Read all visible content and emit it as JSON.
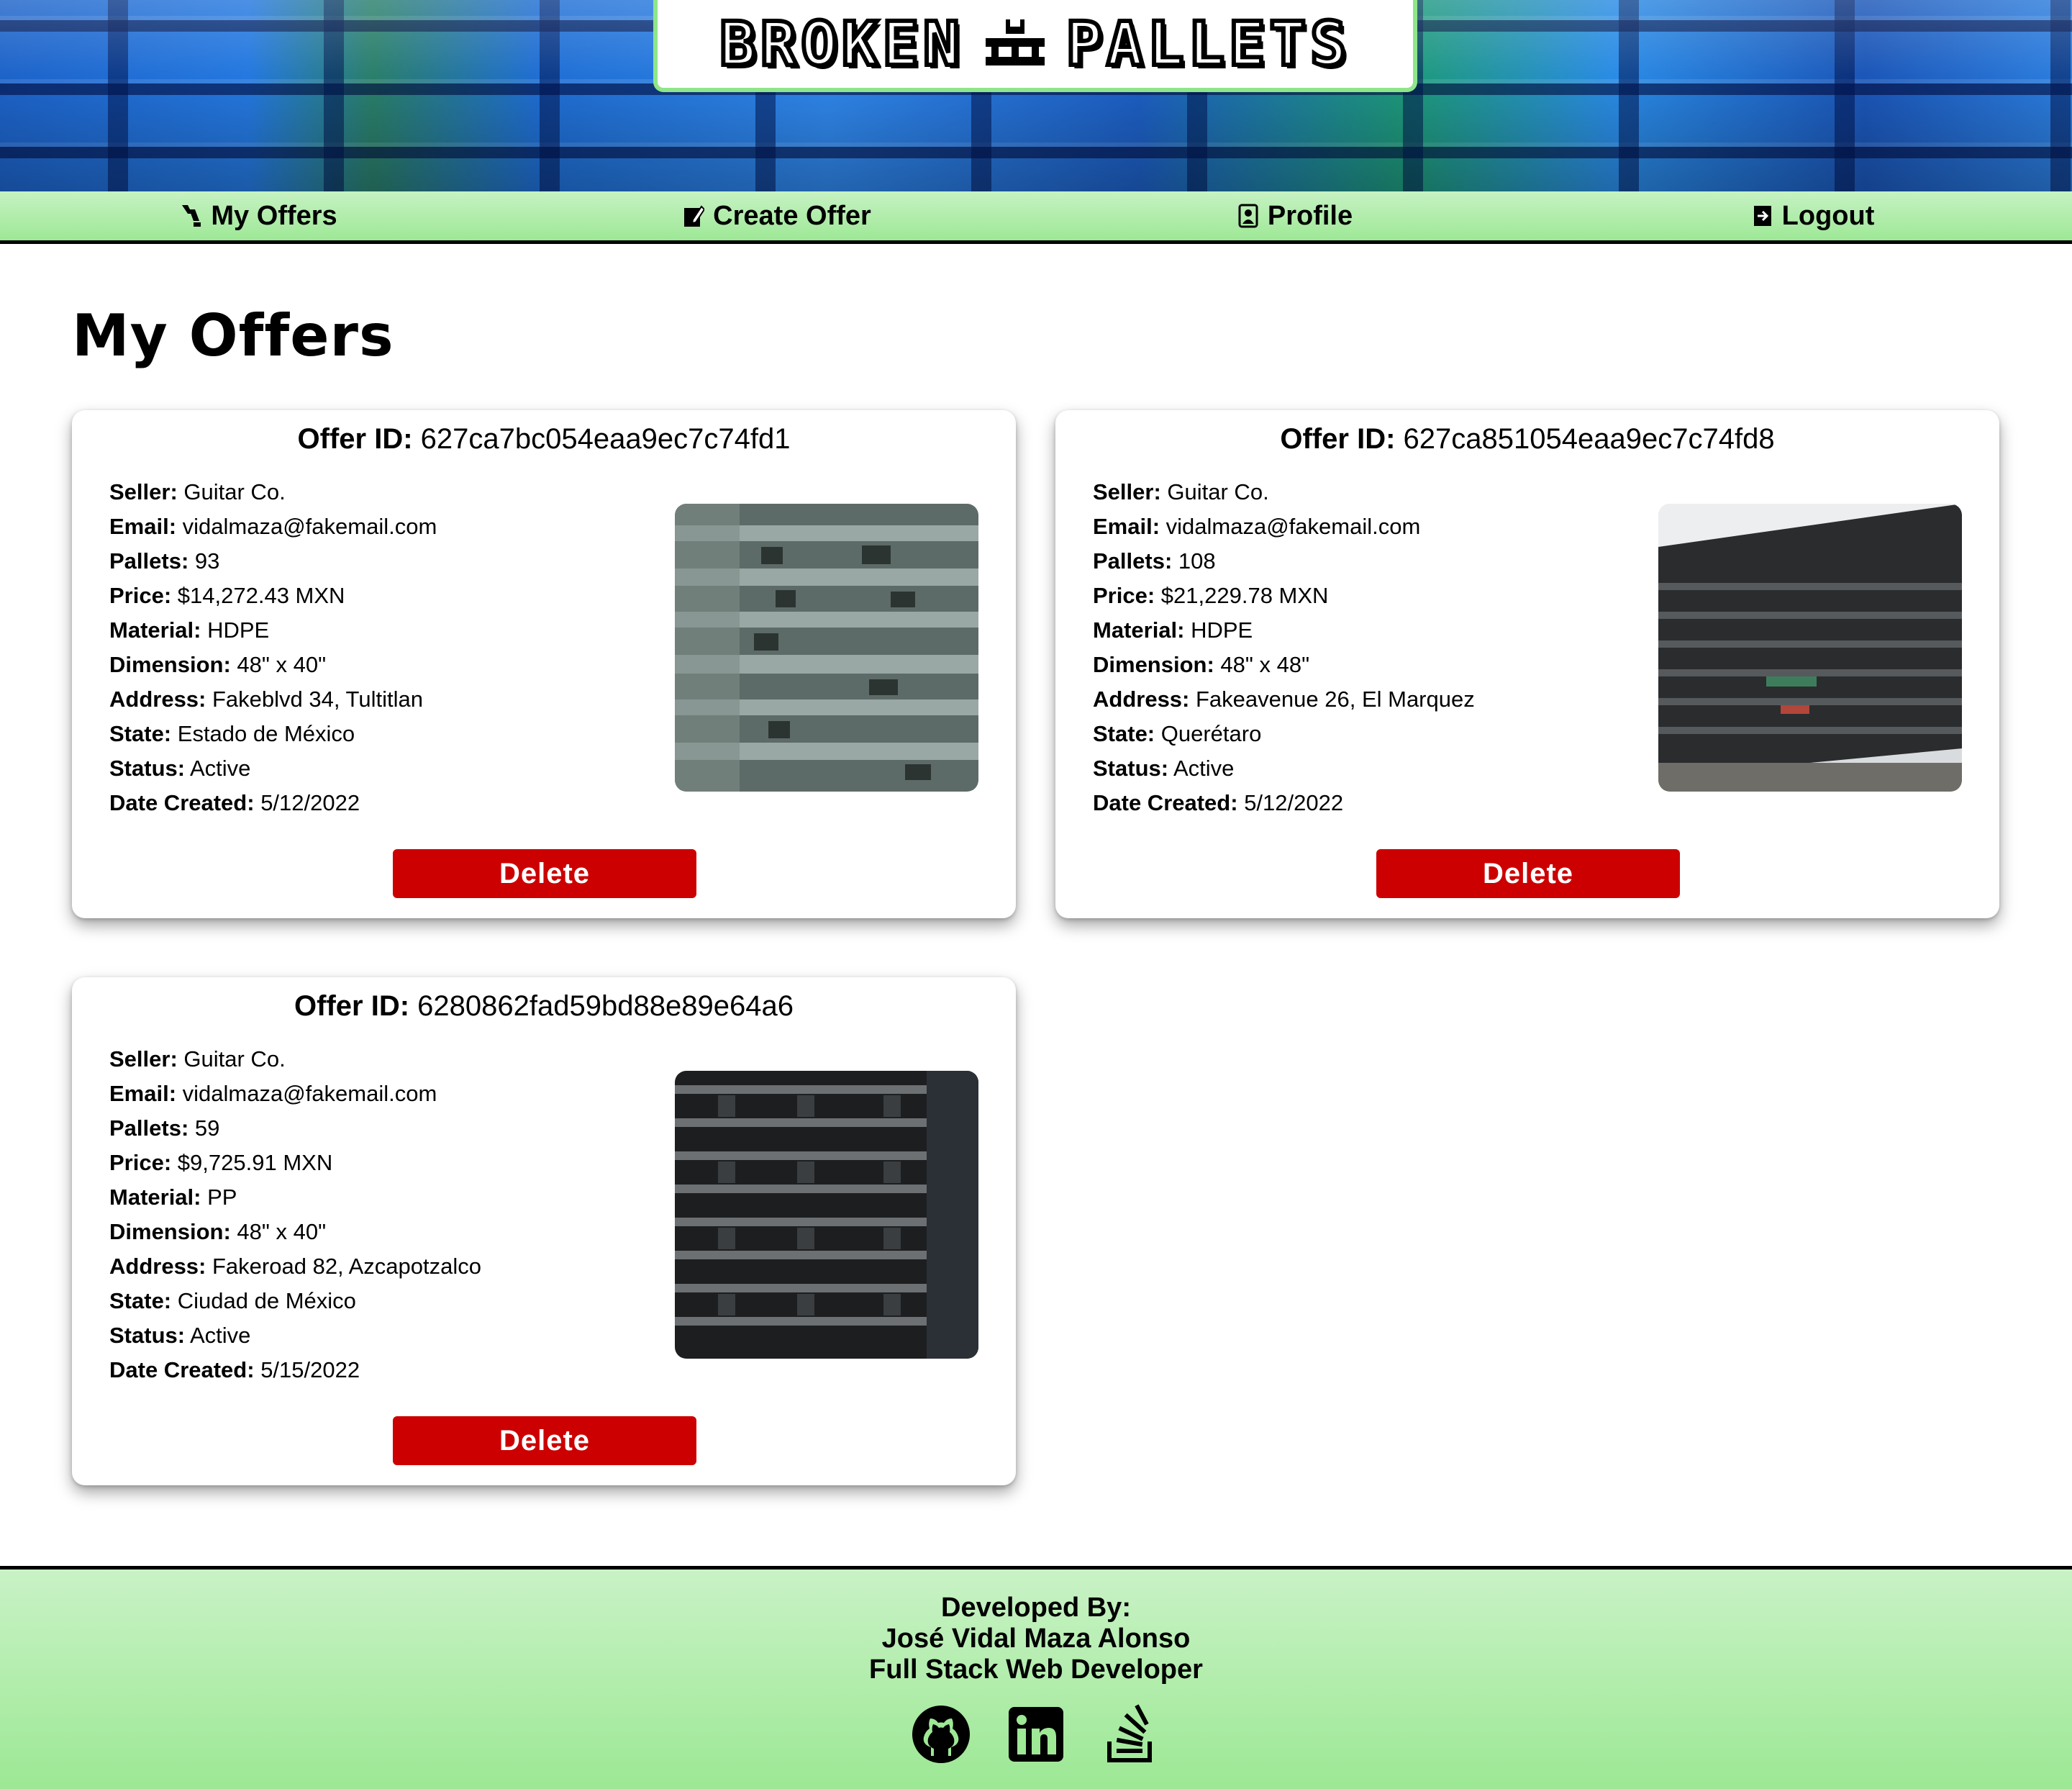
{
  "brand": {
    "word1": "BROKEN",
    "word2": "PALLETS",
    "logo_icon": "pallet-icon"
  },
  "nav": {
    "items": [
      {
        "label": "My Offers",
        "icon": "pallets-icon"
      },
      {
        "label": "Create Offer",
        "icon": "edit-icon"
      },
      {
        "label": "Profile",
        "icon": "person-badge-icon"
      },
      {
        "label": "Logout",
        "icon": "logout-icon"
      }
    ]
  },
  "page": {
    "title": "My Offers"
  },
  "labels": {
    "offer_id": "Offer ID:",
    "seller": "Seller:",
    "email": "Email:",
    "pallets": "Pallets:",
    "price": "Price:",
    "material": "Material:",
    "dimension": "Dimension:",
    "address": "Address:",
    "state": "State:",
    "status": "Status:",
    "date_created": "Date Created:",
    "delete": "Delete"
  },
  "offers": [
    {
      "id": "627ca7bc054eaa9ec7c74fd1",
      "seller": "Guitar Co.",
      "email": "vidalmaza@fakemail.com",
      "pallets": "93",
      "price": "$14,272.43 MXN",
      "material": "HDPE",
      "dimension": "48\" x 40\"",
      "address": "Fakeblvd 34, Tultitlan",
      "state": "Estado de México",
      "status": "Active",
      "date_created": "5/12/2022"
    },
    {
      "id": "627ca851054eaa9ec7c74fd8",
      "seller": "Guitar Co.",
      "email": "vidalmaza@fakemail.com",
      "pallets": "108",
      "price": "$21,229.78 MXN",
      "material": "HDPE",
      "dimension": "48\" x 48\"",
      "address": "Fakeavenue 26, El Marquez",
      "state": "Querétaro",
      "status": "Active",
      "date_created": "5/12/2022"
    },
    {
      "id": "6280862fad59bd88e89e64a6",
      "seller": "Guitar Co.",
      "email": "vidalmaza@fakemail.com",
      "pallets": "59",
      "price": "$9,725.91 MXN",
      "material": "PP",
      "dimension": "48\" x 40\"",
      "address": "Fakeroad 82, Azcapotzalco",
      "state": "Ciudad de México",
      "status": "Active",
      "date_created": "5/15/2022"
    }
  ],
  "footer": {
    "line1": "Developed By:",
    "line2": "José Vidal Maza Alonso",
    "line3": "Full Stack Web Developer",
    "social_icons": [
      "github-icon",
      "linkedin-icon",
      "stackoverflow-icon"
    ]
  },
  "colors": {
    "accent_green": "#9ee896",
    "delete_red": "#cc0000"
  }
}
